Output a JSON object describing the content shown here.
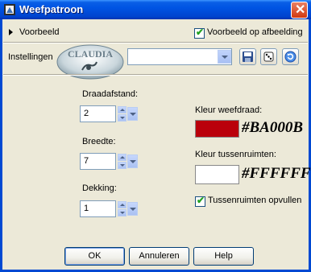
{
  "window": {
    "title": "Weefpatroon"
  },
  "preview": {
    "label": "Voorbeeld",
    "checkbox_label": "Voorbeeld op afbeelding",
    "checked": true
  },
  "settings": {
    "label": "Instellingen",
    "preset_value": "",
    "logo_text": "CLAUDIA"
  },
  "fields": {
    "distance": {
      "label": "Draadafstand:",
      "value": "2"
    },
    "width": {
      "label": "Breedte:",
      "value": "7"
    },
    "opacity": {
      "label": "Dekking:",
      "value": "1"
    }
  },
  "colors": {
    "thread": {
      "label": "Kleur weefdraad:",
      "hex": "#BA000B",
      "swatch": "#BA000B"
    },
    "gap": {
      "label": "Kleur tussenruimten:",
      "hex": "#FFFFFF",
      "swatch": "#FFFFFF"
    },
    "fill": {
      "label": "Tussenruimten opvullen",
      "checked": true
    }
  },
  "buttons": {
    "ok": "OK",
    "cancel": "Annuleren",
    "help": "Help"
  }
}
